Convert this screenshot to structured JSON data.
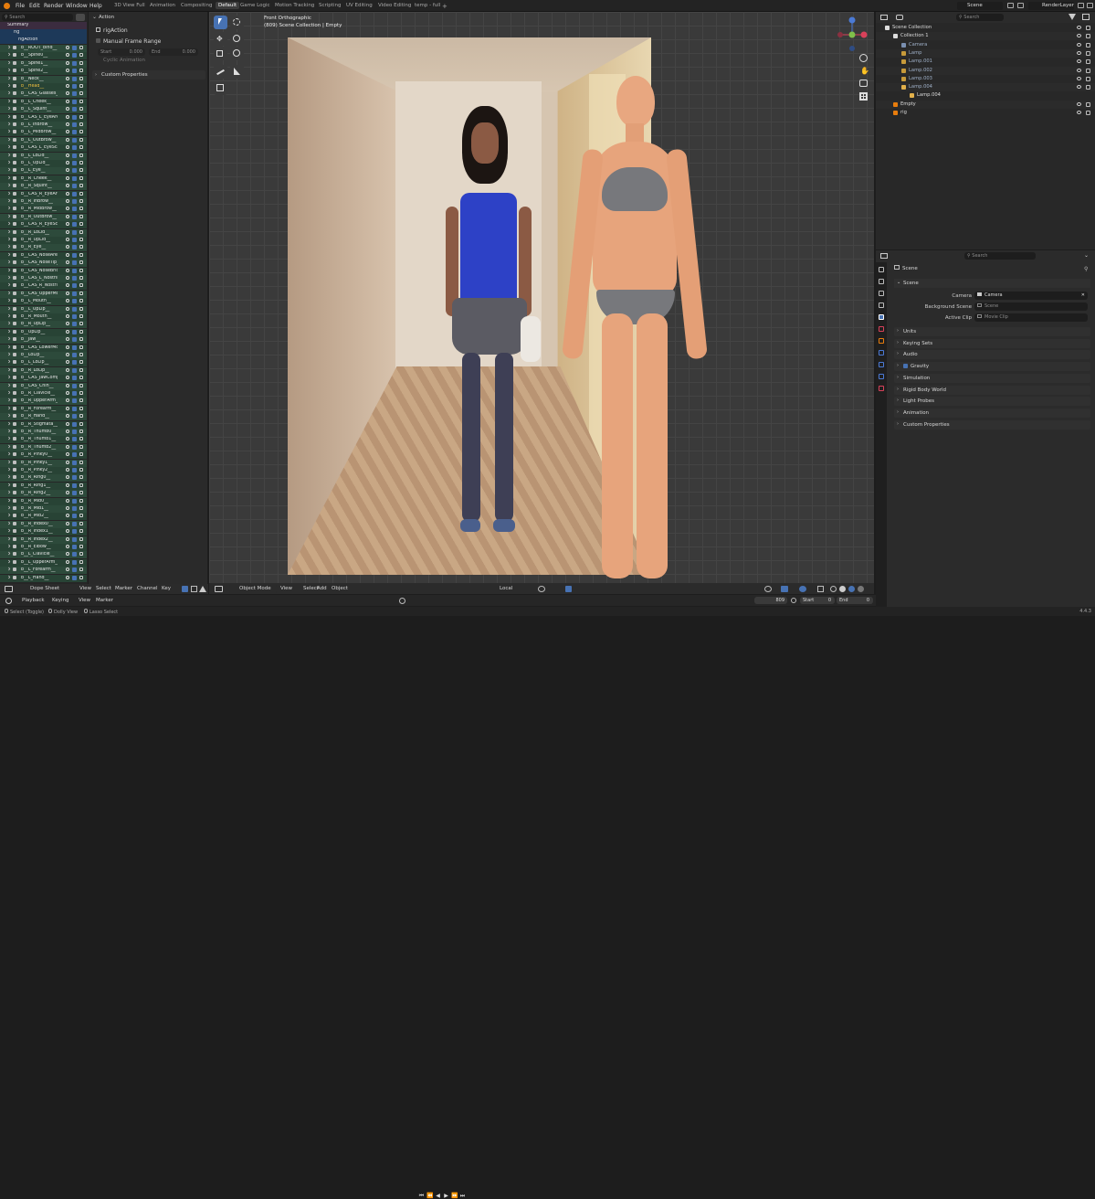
{
  "menu": [
    "File",
    "Edit",
    "Render",
    "Window",
    "Help"
  ],
  "workspaces": [
    "3D View Full",
    "Animation",
    "Compositing",
    "Default",
    "Game Logic",
    "Motion Tracking",
    "Scripting",
    "UV Editing",
    "Video Editing",
    "temp - full"
  ],
  "active_workspace": "Default",
  "scene_name": "Scene",
  "render_layer": "RenderLayer",
  "left_search_placeholder": "Search",
  "left_panel": {
    "summary": "Summary",
    "rig": "rig",
    "rig_action": "rigAction",
    "bones": [
      "b__ROOT_bind__",
      "b__Spine0__",
      "b__Spine1__",
      "b__Spine2__",
      "b__Neck__",
      "b__Head__",
      "b__CAS_Glasses__",
      "b__L_Cheek__",
      "b__L_Squint__",
      "b__CAS_L_EyeArea__",
      "b__L_InBrow__",
      "b__L_MidBrow__",
      "b__L_OutBrow__",
      "b__CAS_L_EyeScale__",
      "b__L_LoLid__",
      "b__L_UpLid__",
      "b__L_Eye__",
      "b__R_Cheek__",
      "b__R_Squint__",
      "b__CAS_R_EyeArea__",
      "b__R_InBrow__",
      "b__R_MidBrow__",
      "b__R_OutBrow__",
      "b__CAS_R_EyeScale__",
      "b__R_LoLid__",
      "b__R_UpLid__",
      "b__R_Eye__",
      "b__CAS_NoseArea__",
      "b__CAS_NoseTip__",
      "b__CAS_NoseBridge__",
      "b__CAS_L_Nostril__",
      "b__CAS_R_Nostril__",
      "b__CAS_UpperMouth__",
      "b__L_Mouth__",
      "b__L_UpLip__",
      "b__R_Mouth__",
      "b__R_UpLip__",
      "b__UpLip__",
      "b__Jaw__",
      "b__CAS_LowerMouth__",
      "b__LoLip__",
      "b__L_LoLip__",
      "b__R_LoLip__",
      "b__CAS_JawComp__",
      "b__CAS_Chin__",
      "b__R_Clavicle__",
      "b__R_UpperArm__",
      "b__R_Forearm__",
      "b__R_Hand__",
      "b__R_Stigmata__",
      "b__R_Thumb0__",
      "b__R_Thumb1__",
      "b__R_Thumb2__",
      "b__R_Pinky0__",
      "b__R_Pinky1__",
      "b__R_Pinky2__",
      "b__R_Ring0__",
      "b__R_Ring1__",
      "b__R_Ring2__",
      "b__R_Mid0__",
      "b__R_Mid1__",
      "b__R_Mid2__",
      "b__R_Index0__",
      "b__R_Index1__",
      "b__R_Index2__",
      "b__R_Elbow__",
      "b__L_Clavicle__",
      "b__L_UpperArm__",
      "b__L_Forearm__",
      "b__L_Hand__"
    ]
  },
  "action_panel": {
    "title": "Action",
    "action_name": "rigAction",
    "manual_frame_range": "Manual Frame Range",
    "start_label": "Start",
    "start_value": "0.000",
    "end_label": "End",
    "end_value": "0.000",
    "cyclic": "Cyclic Animation",
    "custom_props": "Custom Properties"
  },
  "viewport": {
    "view_name": "Front Orthographic",
    "context": "(809) Scene Collection | Empty"
  },
  "viewport_header": {
    "mode": "Object Mode",
    "menus": [
      "View",
      "Select",
      "Add",
      "Object"
    ],
    "transform": "Local"
  },
  "dope_header": {
    "editor": "Dope Sheet",
    "menus": [
      "View",
      "Select",
      "Marker",
      "Channel",
      "Key"
    ]
  },
  "timeline": {
    "menus": [
      "Playback",
      "Keying",
      "View",
      "Marker"
    ],
    "current_frame": "809",
    "start_label": "Start",
    "start": "0",
    "end_label": "End",
    "end": "0"
  },
  "status": {
    "items": [
      "Select (Toggle)",
      "Dolly View",
      "Lasso Select"
    ],
    "version": "4.4.3"
  },
  "outliner": {
    "search_placeholder": "Search",
    "items": [
      {
        "name": "Scene Collection",
        "level": 0
      },
      {
        "name": "Collection 1",
        "level": 1
      },
      {
        "name": "Camera",
        "level": 2
      },
      {
        "name": "Lamp",
        "level": 2
      },
      {
        "name": "Lamp.001",
        "level": 2
      },
      {
        "name": "Lamp.002",
        "level": 2
      },
      {
        "name": "Lamp.003",
        "level": 2
      },
      {
        "name": "Lamp.004",
        "level": 2
      },
      {
        "name": "Lamp.004",
        "level": 3
      },
      {
        "name": "Empty",
        "level": 1
      },
      {
        "name": "rig",
        "level": 1
      }
    ]
  },
  "properties": {
    "search_placeholder": "Search",
    "breadcrumb": "Scene",
    "section": "Scene",
    "camera_label": "Camera",
    "camera_value": "Camera",
    "bg_label": "Background Scene",
    "bg_placeholder": "Scene",
    "clip_label": "Active Clip",
    "clip_placeholder": "Movie Clip",
    "panels": [
      "Units",
      "Keying Sets",
      "Audio",
      "Gravity",
      "Simulation",
      "Rigid Body World",
      "Light Probes",
      "Animation",
      "Custom Properties"
    ]
  }
}
